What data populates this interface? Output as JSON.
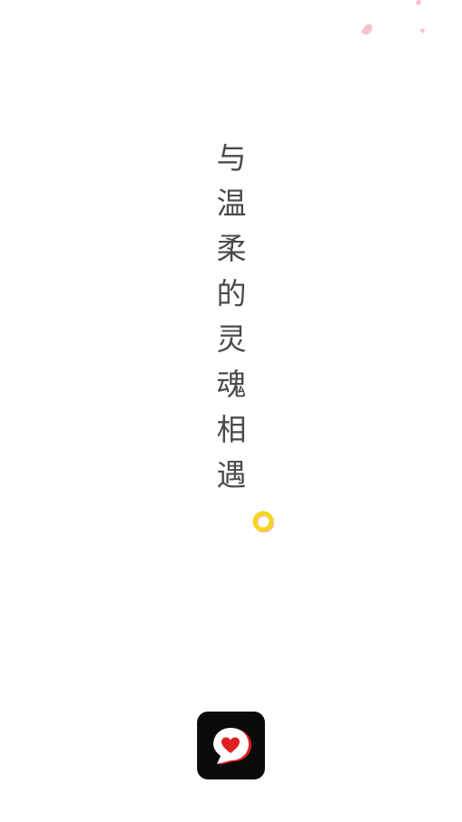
{
  "splash": {
    "slogan_chars": [
      "与",
      "温",
      "柔",
      "的",
      "灵",
      "魂",
      "相",
      "遇"
    ]
  },
  "loader": {
    "icon": "loading-ring-icon",
    "color": "#f5d623"
  },
  "app_logo": {
    "icon": "heart-chat-bubble-icon",
    "background": "#0a0a0a",
    "heart_color": "#e02020"
  },
  "decorations": {
    "icon": "petal-icon",
    "color": "#f6b8c0"
  }
}
